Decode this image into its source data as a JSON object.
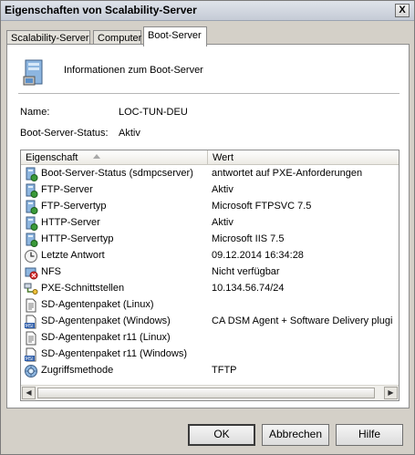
{
  "window": {
    "title": "Eigenschaften von Scalability-Server",
    "close_label": "X"
  },
  "tabs": [
    {
      "label": "Scalability-Server"
    },
    {
      "label": "Computer"
    },
    {
      "label": "Boot-Server"
    }
  ],
  "header": {
    "text": "Informationen zum Boot-Server",
    "icon": "server-icon"
  },
  "fields": {
    "name_label": "Name:",
    "name_value": "LOC-TUN-DEU",
    "status_label": "Boot-Server-Status:",
    "status_value": "Aktiv"
  },
  "grid": {
    "columns": [
      "Eigenschaft",
      "Wert"
    ],
    "rows": [
      {
        "icon": "server-status-icon",
        "property": "Boot-Server-Status (sdmpcserver)",
        "value": "antwortet auf PXE-Anforderungen"
      },
      {
        "icon": "server-status-icon",
        "property": "FTP-Server",
        "value": "Aktiv"
      },
      {
        "icon": "server-status-icon",
        "property": "FTP-Servertyp",
        "value": "Microsoft FTPSVC 7.5"
      },
      {
        "icon": "server-status-icon",
        "property": "HTTP-Server",
        "value": "Aktiv"
      },
      {
        "icon": "server-status-icon",
        "property": "HTTP-Servertyp",
        "value": "Microsoft IIS 7.5"
      },
      {
        "icon": "clock-icon",
        "property": "Letzte Antwort",
        "value": "09.12.2014 16:34:28"
      },
      {
        "icon": "nfs-icon",
        "property": "NFS",
        "value": "Nicht verfügbar"
      },
      {
        "icon": "network-icon",
        "property": "PXE-Schnittstellen",
        "value": "10.134.56.74/24"
      },
      {
        "icon": "document-icon",
        "property": "SD-Agentenpaket (Linux)",
        "value": ""
      },
      {
        "icon": "msi-icon",
        "property": "SD-Agentenpaket (Windows)",
        "value": "CA DSM Agent + Software Delivery plugi"
      },
      {
        "icon": "document-icon",
        "property": "SD-Agentenpaket r11 (Linux)",
        "value": ""
      },
      {
        "icon": "msi-icon",
        "property": "SD-Agentenpaket r11 (Windows)",
        "value": ""
      },
      {
        "icon": "access-icon",
        "property": "Zugriffsmethode",
        "value": "TFTP"
      }
    ]
  },
  "buttons": {
    "ok": "OK",
    "cancel": "Abbrechen",
    "help": "Hilfe"
  }
}
